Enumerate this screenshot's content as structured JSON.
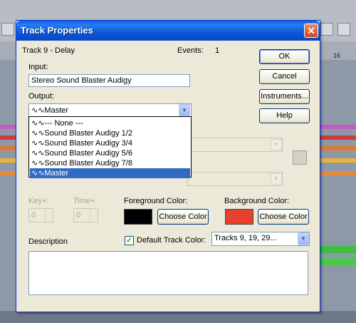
{
  "background": {
    "ruler_label": "16"
  },
  "dialog": {
    "title": "Track Properties",
    "close_glyph": "✕",
    "track_name": "Track 9 - Delay",
    "events_label": "Events:",
    "events_value": "1",
    "input_label": "Input:",
    "input_value": "Stereo Sound Blaster Audigy",
    "output_label": "Output:",
    "output_value": "∿∿Master",
    "output_options": [
      "∿∿--- None ---",
      "∿∿Sound Blaster Audigy 1/2",
      "∿∿Sound Blaster Audigy 3/4",
      "∿∿Sound Blaster Audigy 5/6",
      "∿∿Sound Blaster Audigy 7/8",
      "∿∿Master"
    ],
    "output_selected_index": 5,
    "buttons": {
      "ok": "OK",
      "cancel": "Cancel",
      "instruments": "Instruments...",
      "help": "Help"
    },
    "key_label": "Key+:",
    "key_value": "0",
    "time_label": "Time+:",
    "time_value": "0",
    "foreground_label": "Foreground Color:",
    "foreground_color": "#000000",
    "foreground_button": "Choose Color",
    "background_label": "Background Color:",
    "background_color": "#e8402e",
    "background_button": "Choose Color",
    "default_track_color_label": "Default Track Color:",
    "default_track_color_checked": true,
    "tracks_combo_value": "Tracks 9, 19, 29...",
    "description_label": "Description",
    "description_value": ""
  }
}
